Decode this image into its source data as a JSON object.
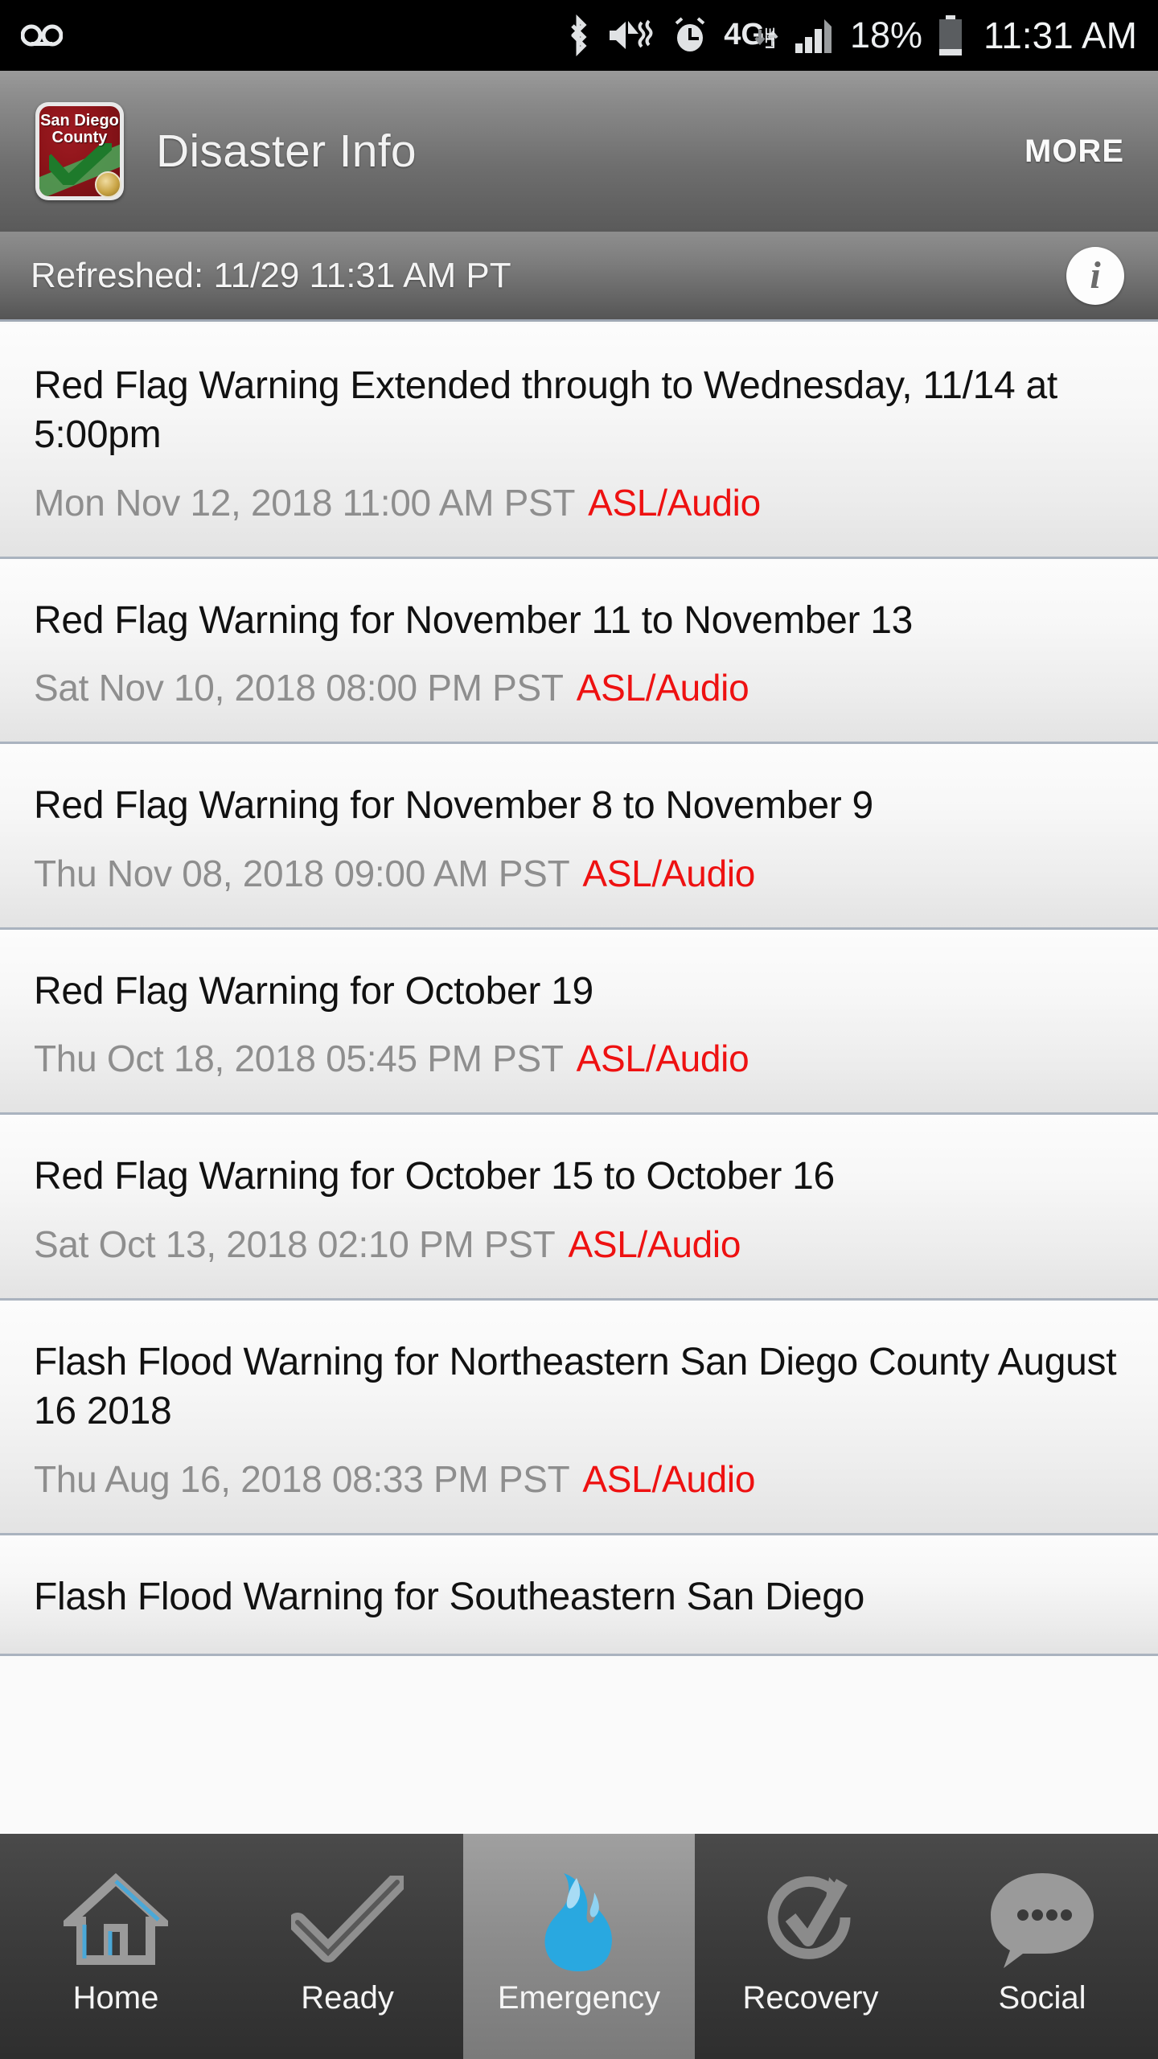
{
  "statusbar": {
    "left_icons": [
      {
        "name": "voicemail-icon"
      }
    ],
    "right_icons": [
      {
        "name": "bluetooth-icon"
      },
      {
        "name": "mute-vibrate-icon"
      },
      {
        "name": "alarm-icon"
      },
      {
        "name": "4g-lte-icon",
        "label": "4G",
        "sublabel": "LTE"
      },
      {
        "name": "signal-bars-icon"
      }
    ],
    "battery_percent": "18%",
    "time": "11:31 AM"
  },
  "header": {
    "logo_line1": "San Diego",
    "logo_line2": "County",
    "title": "Disaster Info",
    "more_label": "MORE"
  },
  "refresh": {
    "text": "Refreshed: 11/29 11:31 AM PT",
    "info_glyph": "i"
  },
  "list": {
    "asl_label": "ASL/Audio",
    "items": [
      {
        "title": "Red Flag Warning Extended through to Wednesday, 11/14 at 5:00pm",
        "date": "Mon Nov 12, 2018 11:00 AM PST",
        "asl": "ASL/Audio"
      },
      {
        "title": "Red Flag Warning for November 11 to November 13",
        "date": "Sat Nov 10, 2018 08:00 PM PST",
        "asl": "ASL/Audio"
      },
      {
        "title": "Red Flag Warning for November 8 to November 9",
        "date": "Thu Nov 08, 2018 09:00 AM PST",
        "asl": "ASL/Audio"
      },
      {
        "title": "Red Flag Warning for October 19",
        "date": "Thu Oct 18, 2018 05:45 PM PST",
        "asl": "ASL/Audio"
      },
      {
        "title": "Red Flag Warning for October 15 to October 16",
        "date": "Sat Oct 13, 2018 02:10 PM PST",
        "asl": "ASL/Audio"
      },
      {
        "title": "Flash Flood Warning for Northeastern San Diego County August 16 2018",
        "date": "Thu Aug 16, 2018 08:33 PM PST",
        "asl": "ASL/Audio"
      },
      {
        "title": "Flash Flood Warning for Southeastern San Diego",
        "date": "",
        "asl": ""
      }
    ]
  },
  "tabbar": {
    "tabs": [
      {
        "label": "Home",
        "icon": "home-icon",
        "selected": false
      },
      {
        "label": "Ready",
        "icon": "checkmark-icon",
        "selected": false
      },
      {
        "label": "Emergency",
        "icon": "flame-icon",
        "selected": true
      },
      {
        "label": "Recovery",
        "icon": "recovery-arrow-check-icon",
        "selected": false
      },
      {
        "label": "Social",
        "icon": "chat-bubble-icon",
        "selected": false
      }
    ]
  },
  "colors": {
    "accent_red": "#ee1111",
    "emergency_blue": "#29a8e0",
    "divider": "#aab3bf"
  }
}
